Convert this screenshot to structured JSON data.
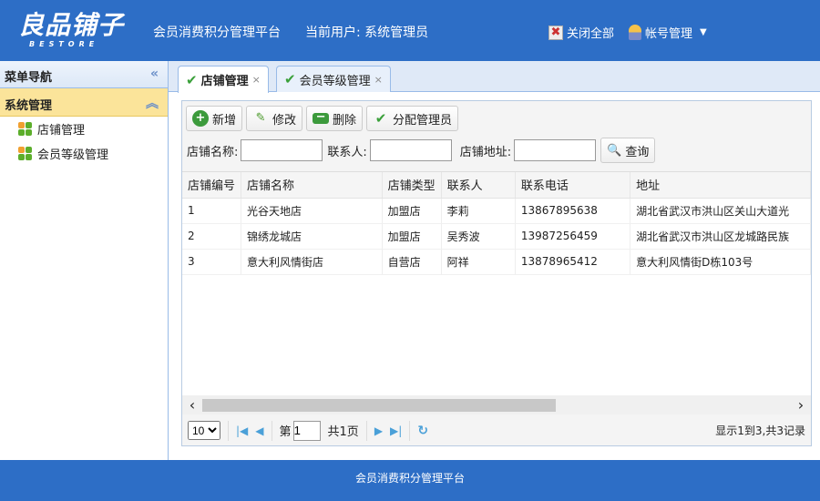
{
  "header": {
    "logo": "良品铺子",
    "logo_sub": "BESTORE",
    "title": "会员消费积分管理平台",
    "current_user": "当前用户: 系统管理员",
    "close_all": "关闭全部",
    "account": "帐号管理"
  },
  "sidebar": {
    "title": "菜单导航",
    "section": "系统管理",
    "items": [
      {
        "label": "店铺管理"
      },
      {
        "label": "会员等级管理"
      }
    ]
  },
  "tabs": [
    {
      "label": "店铺管理",
      "active": true
    },
    {
      "label": "会员等级管理",
      "active": false
    }
  ],
  "toolbar": {
    "add": "新增",
    "edit": "修改",
    "delete": "删除",
    "assign": "分配管理员"
  },
  "search": {
    "name_label": "店铺名称:",
    "contact_label": "联系人:",
    "address_label": "店铺地址:",
    "query": "查询",
    "name_value": "",
    "contact_value": "",
    "address_value": ""
  },
  "table": {
    "columns": [
      "店铺编号",
      "店铺名称",
      "店铺类型",
      "联系人",
      "联系电话",
      "地址"
    ],
    "rows": [
      [
        "1",
        "光谷天地店",
        "加盟店",
        "李莉",
        "13867895638",
        "湖北省武汉市洪山区关山大道光"
      ],
      [
        "2",
        "锦绣龙城店",
        "加盟店",
        "吴秀波",
        "13987256459",
        "湖北省武汉市洪山区龙城路民族"
      ],
      [
        "3",
        "意大利风情街店",
        "自营店",
        "阿祥",
        "13878965412",
        "意大利风情街D栋103号"
      ]
    ]
  },
  "pager": {
    "page_size": "10",
    "page_prefix": "第",
    "page": "1",
    "page_total": "共1页",
    "info": "显示1到3,共3记录"
  },
  "footer": {
    "text": "会员消费积分管理平台"
  }
}
